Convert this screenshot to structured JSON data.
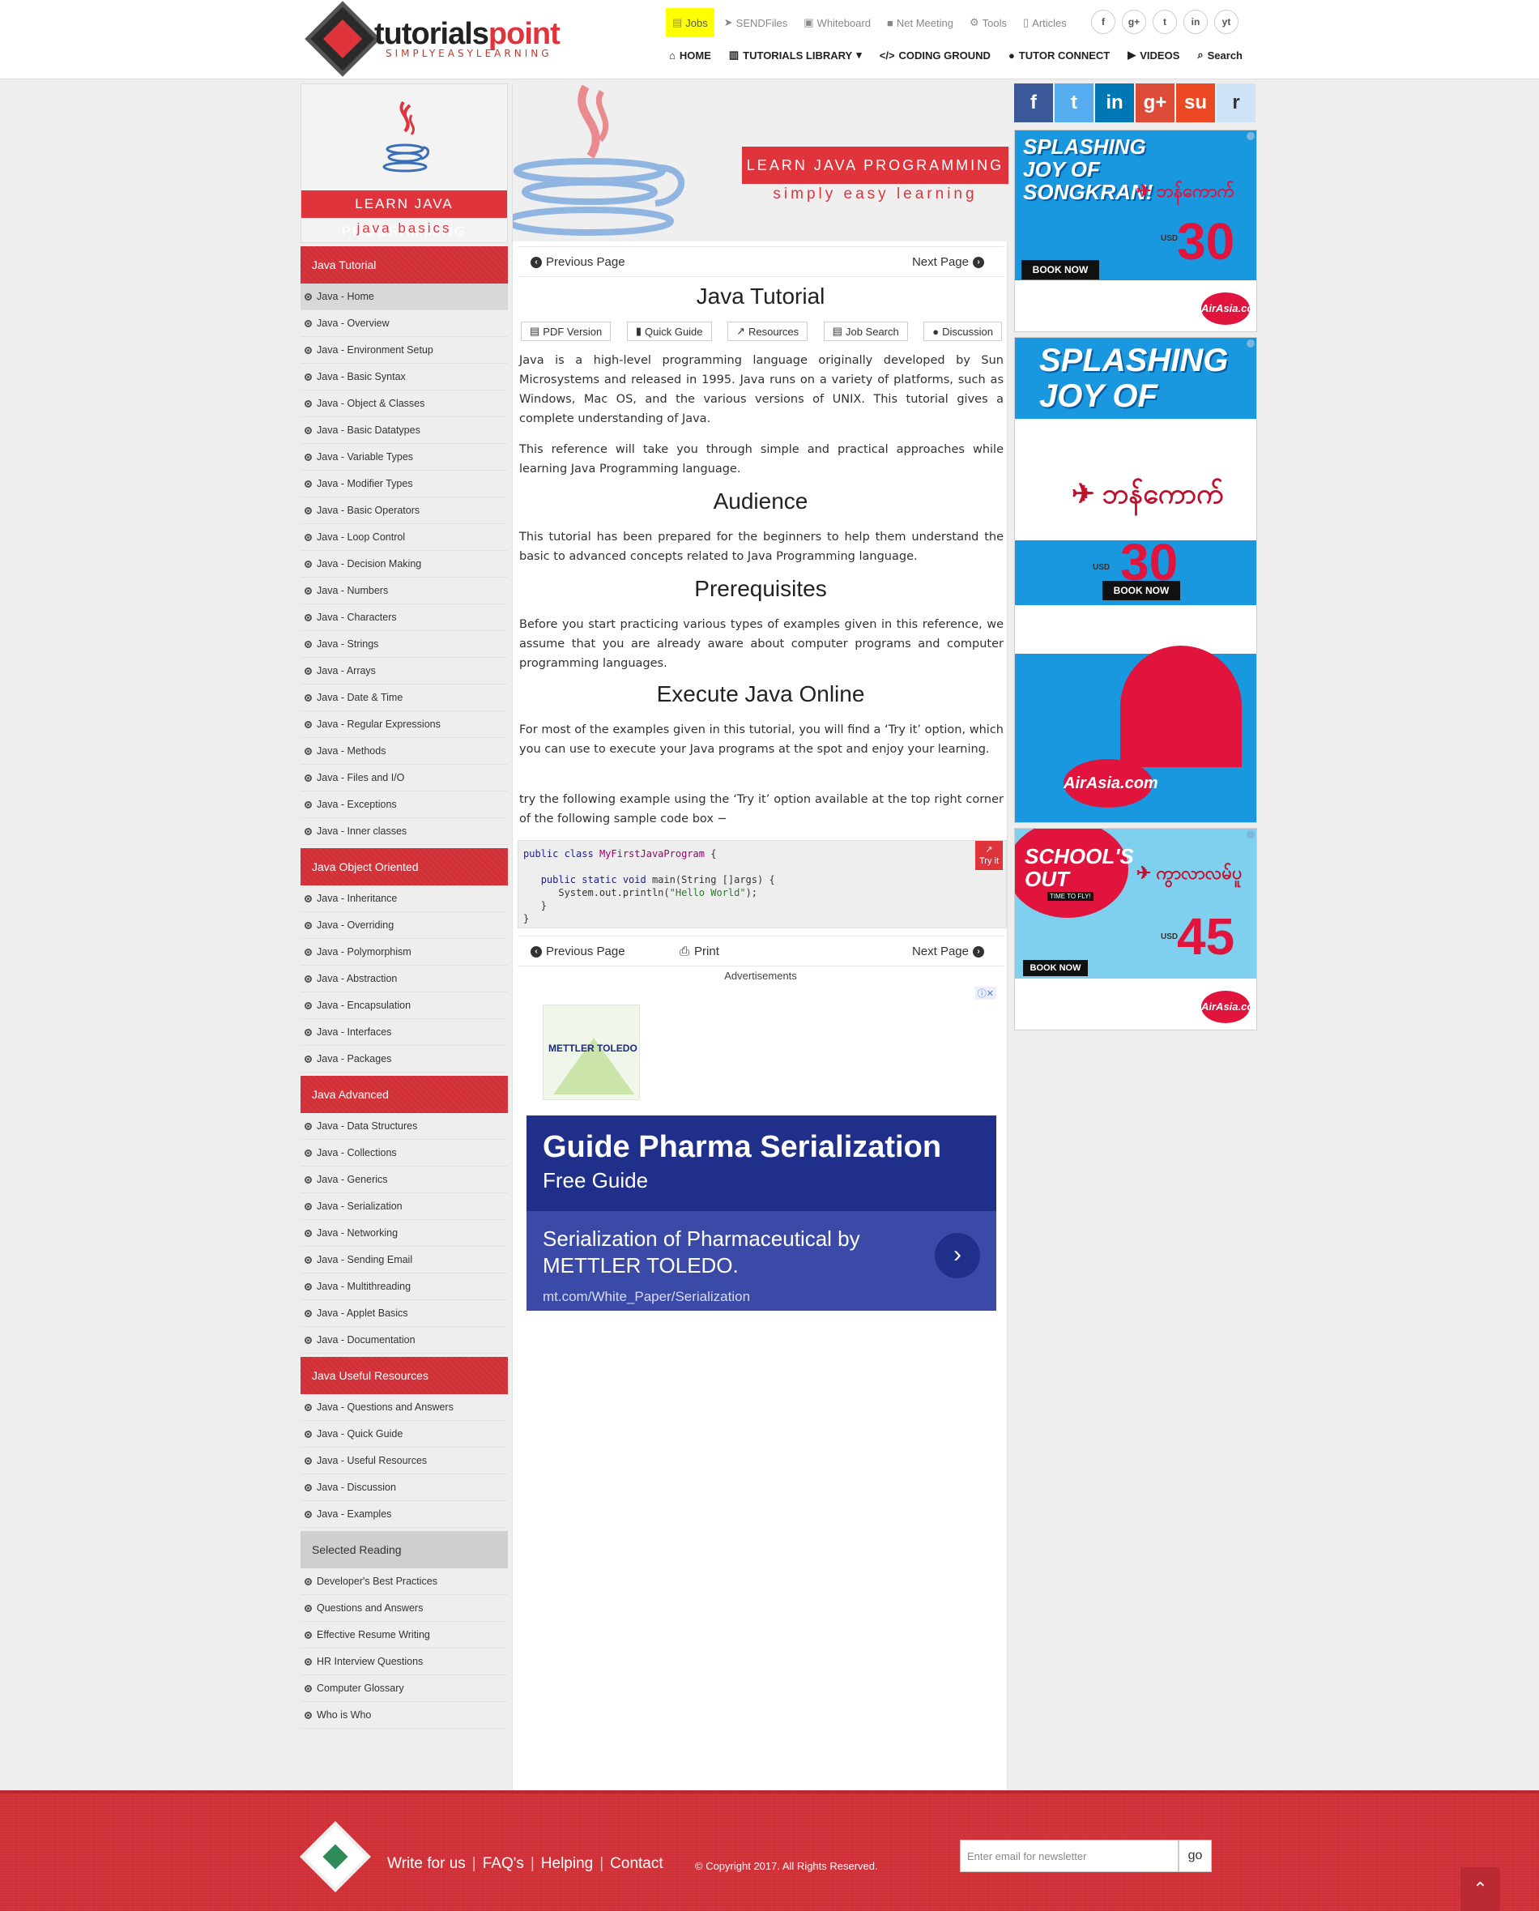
{
  "brand": {
    "name_part1": "tutorials",
    "name_part2": "point",
    "tagline": "SIMPLYEASYLEARNING"
  },
  "topnav": [
    {
      "label": "Jobs",
      "icon": "briefcase-icon"
    },
    {
      "label": "SENDFiles",
      "icon": "paper-plane-icon"
    },
    {
      "label": "Whiteboard",
      "icon": "whiteboard-icon"
    },
    {
      "label": "Net Meeting",
      "icon": "video-camera-icon"
    },
    {
      "label": "Tools",
      "icon": "gear-icon"
    },
    {
      "label": "Articles",
      "icon": "document-icon"
    }
  ],
  "social_top": [
    "f",
    "g+",
    "t",
    "in",
    "yt"
  ],
  "mainnav": [
    {
      "label": "HOME",
      "icon": "home-icon"
    },
    {
      "label": "TUTORIALS LIBRARY",
      "icon": "library-icon"
    },
    {
      "label": "CODING GROUND",
      "icon": "code-icon"
    },
    {
      "label": "TUTOR CONNECT",
      "icon": "user-icon"
    },
    {
      "label": "VIDEOS",
      "icon": "play-icon"
    },
    {
      "label": "Search",
      "icon": "search-icon"
    }
  ],
  "sidebar": {
    "banner_title": "LEARN JAVA PROGRAMMING",
    "banner_sub": "java basics",
    "sections": [
      {
        "title": "Java Tutorial",
        "items": [
          "Java - Home",
          "Java - Overview",
          "Java - Environment Setup",
          "Java - Basic Syntax",
          "Java - Object & Classes",
          "Java - Basic Datatypes",
          "Java - Variable Types",
          "Java - Modifier Types",
          "Java - Basic Operators",
          "Java - Loop Control",
          "Java - Decision Making",
          "Java - Numbers",
          "Java - Characters",
          "Java - Strings",
          "Java - Arrays",
          "Java - Date & Time",
          "Java - Regular Expressions",
          "Java - Methods",
          "Java - Files and I/O",
          "Java - Exceptions",
          "Java - Inner classes"
        ]
      },
      {
        "title": "Java Object Oriented",
        "items": [
          "Java - Inheritance",
          "Java - Overriding",
          "Java - Polymorphism",
          "Java - Abstraction",
          "Java - Encapsulation",
          "Java - Interfaces",
          "Java - Packages"
        ]
      },
      {
        "title": "Java Advanced",
        "items": [
          "Java - Data Structures",
          "Java - Collections",
          "Java - Generics",
          "Java - Serialization",
          "Java - Networking",
          "Java - Sending Email",
          "Java - Multithreading",
          "Java - Applet Basics",
          "Java - Documentation"
        ]
      },
      {
        "title": "Java Useful Resources",
        "items": [
          "Java - Questions and Answers",
          "Java - Quick Guide",
          "Java - Useful Resources",
          "Java - Discussion",
          "Java - Examples"
        ]
      },
      {
        "title": "Selected Reading",
        "items": [
          "Developer's Best Practices",
          "Questions and Answers",
          "Effective Resume Writing",
          "HR Interview Questions",
          "Computer Glossary",
          "Who is Who"
        ]
      }
    ]
  },
  "content": {
    "banner_title": "LEARN JAVA PROGRAMMING",
    "banner_sub": "simply easy learning",
    "prev_label": "Previous Page",
    "next_label": "Next Page",
    "print_label": "Print",
    "title": "Java Tutorial",
    "tabs": [
      "PDF Version",
      "Quick Guide",
      "Resources",
      "Job Search",
      "Discussion"
    ],
    "p1": "Java is a high-level programming language originally developed by Sun Microsystems and released in 1995. Java runs on a variety of platforms, such as Windows, Mac OS, and the various versions of UNIX. This tutorial gives a complete understanding of Java.",
    "p2": "This reference will take you through simple and practical approaches while learning Java Programming language.",
    "h_audience": "Audience",
    "p3": "This tutorial has been prepared for the beginners to help them understand the basic to advanced concepts related to Java Programming language.",
    "h_prereq": "Prerequisites",
    "p4": "Before you start practicing various types of examples given in this reference, we assume that you are already aware about computer programs and computer programming languages.",
    "h_execute": "Execute Java Online",
    "p5": "For most of the examples given in this tutorial, you will find a ‘Try it’ option, which you can use to execute your Java programs at the spot and enjoy your learning.",
    "p6": "try the following example using the ‘Try it’ option available at the top right corner of the following sample code box −",
    "code": {
      "l1_kw": "public class",
      "l1_cls": "MyFirstJavaProgram",
      "l1_rest": " {",
      "l3_kw": "public static void",
      "l3_rest": " main(String []args) {",
      "l4_pre": "System.out.println(",
      "l4_str": "\"Hello World\"",
      "l4_post": ");",
      "l5": "}",
      "l6": "}"
    },
    "tryit_label": "Try it",
    "ads_label": "Advertisements",
    "ad": {
      "logo_text": "METTLER TOLEDO",
      "headline": "Guide Pharma Serialization",
      "subhead": "Free Guide",
      "desc": "Serialization of Pharmaceutical by METTLER TOLEDO.",
      "url": "mt.com/White_Paper/Serialization"
    }
  },
  "right": {
    "share": [
      {
        "label": "f",
        "color": "#3b5998"
      },
      {
        "label": "t",
        "color": "#55acee"
      },
      {
        "label": "in",
        "color": "#0077b5"
      },
      {
        "label": "g+",
        "color": "#dd4b39"
      },
      {
        "label": "su",
        "color": "#eb4924"
      },
      {
        "label": "r",
        "color": "#cee3f8"
      }
    ],
    "ad1": {
      "headline": "SPLASHING JOY OF SONGKRAN!",
      "price": "30",
      "book": "BOOK NOW",
      "brand": "AirAsia.com",
      "usd": "USD"
    },
    "ad2": {
      "headline": "SPLASHING JOY OF SONGKRAN!",
      "price": "30",
      "book": "BOOK NOW",
      "brand": "AirAsia.com",
      "usd": "USD"
    },
    "ad3": {
      "headline": "SCHOOL'S OUT",
      "tag": "TIME TO FLY!",
      "price": "45",
      "book": "BOOK NOW",
      "brand": "AirAsia.com",
      "usd": "USD"
    }
  },
  "footer": {
    "links": [
      "Write for us",
      "FAQ's",
      "Helping",
      "Contact"
    ],
    "copyright": "© Copyright 2017. All Rights Reserved.",
    "newsletter_placeholder": "Enter email for newsletter",
    "go_label": "go"
  }
}
